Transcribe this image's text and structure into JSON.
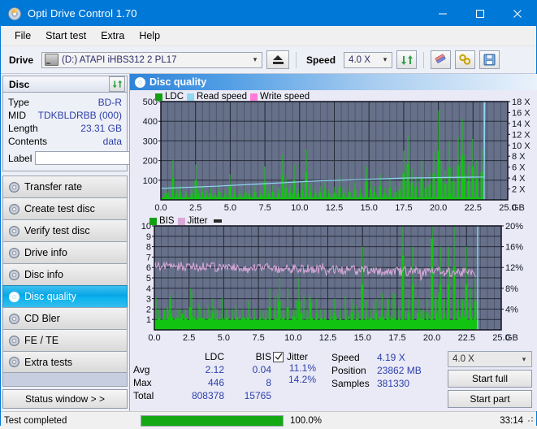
{
  "window": {
    "title": "Opti Drive Control 1.70",
    "icon": "disc-icon",
    "minimize": "minimize-icon",
    "maximize": "maximize-icon",
    "close": "close-icon"
  },
  "menu": {
    "items": [
      "File",
      "Start test",
      "Extra",
      "Help"
    ]
  },
  "toolbar": {
    "drive_label": "Drive",
    "drive_value": "(D:)   ATAPI iHBS312   2 PL17",
    "eject_title": "eject-button",
    "speed_label": "Speed",
    "speed_value": "4.0 X",
    "refresh_title": "refresh-button",
    "erase_title": "erase-button",
    "tools_title": "tools-button",
    "save_title": "save-button"
  },
  "disc_panel": {
    "title": "Disc",
    "refresh_title": "refresh-disc-button",
    "rows": [
      {
        "key": "Type",
        "value": "BD-R"
      },
      {
        "key": "MID",
        "value": "TDKBLDRBB (000)"
      },
      {
        "key": "Length",
        "value": "23.31 GB"
      },
      {
        "key": "Contents",
        "value": "data"
      }
    ],
    "label_key": "Label",
    "label_value": "",
    "label_placeholder": ""
  },
  "sidebar": {
    "items": [
      {
        "label": "Transfer rate",
        "active": false
      },
      {
        "label": "Create test disc",
        "active": false
      },
      {
        "label": "Verify test disc",
        "active": false
      },
      {
        "label": "Drive info",
        "active": false
      },
      {
        "label": "Disc info",
        "active": false
      },
      {
        "label": "Disc quality",
        "active": true
      },
      {
        "label": "CD Bler",
        "active": false
      },
      {
        "label": "FE / TE",
        "active": false
      },
      {
        "label": "Extra tests",
        "active": false
      }
    ],
    "status_window_button": "Status window > >"
  },
  "main": {
    "header_title": "Disc quality",
    "header_icon": "disc-quality-icon"
  },
  "stats": {
    "col_headers": [
      "",
      "LDC",
      "BIS"
    ],
    "rows": [
      {
        "label": "Avg",
        "ldc": "2.12",
        "bis": "0.04"
      },
      {
        "label": "Max",
        "ldc": "446",
        "bis": "8"
      },
      {
        "label": "Total",
        "ldc": "808378",
        "bis": "15765"
      }
    ],
    "jitter": {
      "checked": true,
      "label": "Jitter",
      "avg": "11.1%",
      "max": "14.2%"
    },
    "speed_label": "Speed",
    "speed_value": "4.19 X",
    "position_label": "Position",
    "position_value": "23862 MB",
    "samples_label": "Samples",
    "samples_value": "381330",
    "speed_select": "4.0 X",
    "start_full": "Start full",
    "start_part": "Start part"
  },
  "statusbar": {
    "message": "Test completed",
    "progress_percent": "100.0%",
    "progress_value": 100,
    "elapsed": "33:14"
  },
  "colors": {
    "accent": "#0078d7",
    "plot_bg": "#667089",
    "grid": "#3c4257",
    "ldc_green": "#12c412",
    "read_speed": "#8fd8f2",
    "write_speed": "#ff7ad9",
    "jitter_pink": "#d9a8d9",
    "value_blue": "#2b3fa8",
    "progress_green": "#15a815"
  },
  "chart_data": [
    {
      "type": "line",
      "title": "Disc quality - LDC / Read speed",
      "legend": [
        {
          "name": "LDC",
          "color": "#12c412"
        },
        {
          "name": "Read speed",
          "color": "#8fd8f2"
        },
        {
          "name": "Write speed",
          "color": "#ff7ad9"
        }
      ],
      "legend_position": "top-left",
      "xlabel": "GB",
      "x_ticks": [
        "0.0",
        "2.5",
        "5.0",
        "7.5",
        "10.0",
        "12.5",
        "15.0",
        "17.5",
        "20.0",
        "22.5",
        "25.0"
      ],
      "xlim": [
        0,
        25
      ],
      "ylabel_left": "LDC",
      "y_ticks_left": [
        "100",
        "200",
        "300",
        "400",
        "500"
      ],
      "ylim_left": [
        0,
        500
      ],
      "ylabel_right": "speed",
      "y_ticks_right": [
        "2 X",
        "4 X",
        "6 X",
        "8 X",
        "10 X",
        "12 X",
        "14 X",
        "16 X",
        "18 X"
      ],
      "ylim_right": [
        0,
        18
      ],
      "grid": true,
      "data_end_gb": 23.3,
      "series": [
        {
          "name": "LDC",
          "kind": "spikes",
          "baseline": 10,
          "peaks": [
            [
              0.35,
              60
            ],
            [
              0.55,
              40
            ],
            [
              0.9,
              205
            ],
            [
              1.1,
              55
            ],
            [
              1.4,
              70
            ],
            [
              1.8,
              45
            ],
            [
              2.2,
              60
            ],
            [
              2.5,
              180
            ],
            [
              2.7,
              50
            ],
            [
              3.0,
              70
            ],
            [
              3.3,
              45
            ],
            [
              3.6,
              60
            ],
            [
              3.9,
              42
            ],
            [
              4.2,
              75
            ],
            [
              4.6,
              50
            ],
            [
              5.0,
              130
            ],
            [
              5.3,
              60
            ],
            [
              5.7,
              45
            ],
            [
              6.1,
              65
            ],
            [
              6.4,
              50
            ],
            [
              6.8,
              70
            ],
            [
              7.2,
              48
            ],
            [
              7.5,
              170
            ],
            [
              7.8,
              55
            ],
            [
              8.1,
              75
            ],
            [
              8.5,
              60
            ],
            [
              8.8,
              230
            ],
            [
              9.0,
              110
            ],
            [
              9.3,
              70
            ],
            [
              9.6,
              180
            ],
            [
              9.9,
              60
            ],
            [
              10.2,
              90
            ],
            [
              10.5,
              255
            ],
            [
              10.8,
              80
            ],
            [
              11.1,
              60
            ],
            [
              11.5,
              70
            ],
            [
              11.8,
              90
            ],
            [
              12.1,
              55
            ],
            [
              12.5,
              65
            ],
            [
              12.9,
              120
            ],
            [
              13.2,
              60
            ],
            [
              13.6,
              75
            ],
            [
              14.0,
              90
            ],
            [
              14.4,
              60
            ],
            [
              14.8,
              170
            ],
            [
              15.1,
              95
            ],
            [
              15.4,
              70
            ],
            [
              15.8,
              130
            ],
            [
              16.1,
              65
            ],
            [
              16.5,
              110
            ],
            [
              16.9,
              70
            ],
            [
              17.2,
              90
            ],
            [
              17.5,
              250
            ],
            [
              17.8,
              330
            ],
            [
              18.1,
              160
            ],
            [
              18.4,
              120
            ],
            [
              18.8,
              200
            ],
            [
              19.1,
              110
            ],
            [
              19.4,
              140
            ],
            [
              19.7,
              245
            ],
            [
              20.0,
              455
            ],
            [
              20.2,
              200
            ],
            [
              20.5,
              150
            ],
            [
              20.8,
              300
            ],
            [
              21.1,
              170
            ],
            [
              21.4,
              320
            ],
            [
              21.7,
              410
            ],
            [
              21.9,
              230
            ],
            [
              22.2,
              180
            ],
            [
              22.5,
              310
            ],
            [
              22.8,
              200
            ],
            [
              23.1,
              260
            ]
          ]
        },
        {
          "name": "Read speed",
          "kind": "line",
          "points": [
            [
              0.0,
              2.1
            ],
            [
              1.0,
              2.2
            ],
            [
              2.5,
              2.35
            ],
            [
              4.0,
              2.5
            ],
            [
              5.5,
              2.7
            ],
            [
              7.0,
              2.9
            ],
            [
              8.5,
              3.1
            ],
            [
              10.0,
              3.3
            ],
            [
              11.5,
              3.5
            ],
            [
              13.0,
              3.6
            ],
            [
              14.5,
              3.75
            ],
            [
              16.0,
              3.85
            ],
            [
              17.5,
              4.0
            ],
            [
              19.0,
              4.05
            ],
            [
              20.5,
              4.1
            ],
            [
              22.0,
              4.15
            ],
            [
              23.3,
              4.2
            ],
            [
              23.35,
              18.0
            ]
          ]
        }
      ]
    },
    {
      "type": "line",
      "title": "Disc quality - BIS / Jitter",
      "legend": [
        {
          "name": "BIS",
          "color": "#12c412"
        },
        {
          "name": "Jitter",
          "color": "#d9a8d9"
        }
      ],
      "legend_position": "top-left",
      "xlabel": "GB",
      "x_ticks": [
        "0.0",
        "2.5",
        "5.0",
        "7.5",
        "10.0",
        "12.5",
        "15.0",
        "17.5",
        "20.0",
        "22.5",
        "25.0"
      ],
      "xlim": [
        0,
        25
      ],
      "ylabel_left": "BIS",
      "y_ticks_left": [
        "1",
        "2",
        "3",
        "4",
        "5",
        "6",
        "7",
        "8",
        "9",
        "10"
      ],
      "ylim_left": [
        0,
        10
      ],
      "ylabel_right": "Jitter",
      "y_ticks_right": [
        "4%",
        "8%",
        "12%",
        "16%",
        "20%"
      ],
      "ylim_right": [
        0,
        20
      ],
      "grid": true,
      "data_end_gb": 23.3,
      "series": [
        {
          "name": "BIS",
          "kind": "spikes",
          "baseline": 1,
          "peaks": [
            [
              0.3,
              2
            ],
            [
              0.7,
              2
            ],
            [
              1.0,
              2
            ],
            [
              1.2,
              3
            ],
            [
              1.5,
              2
            ],
            [
              1.7,
              2
            ],
            [
              1.9,
              2
            ],
            [
              2.2,
              2
            ],
            [
              2.6,
              4
            ],
            [
              2.9,
              2
            ],
            [
              3.2,
              2
            ],
            [
              3.6,
              2
            ],
            [
              4.0,
              2
            ],
            [
              4.2,
              3
            ],
            [
              4.5,
              2
            ],
            [
              4.9,
              2
            ],
            [
              5.2,
              2
            ],
            [
              5.6,
              2
            ],
            [
              6.0,
              2
            ],
            [
              6.4,
              2
            ],
            [
              6.8,
              2
            ],
            [
              7.2,
              2
            ],
            [
              7.6,
              2
            ],
            [
              8.0,
              2
            ],
            [
              8.3,
              4
            ],
            [
              8.7,
              2
            ],
            [
              9.0,
              5
            ],
            [
              9.3,
              2
            ],
            [
              9.6,
              4
            ],
            [
              10.0,
              2
            ],
            [
              10.4,
              5
            ],
            [
              10.6,
              3
            ],
            [
              11.0,
              2
            ],
            [
              11.3,
              2
            ],
            [
              11.7,
              3
            ],
            [
              12.0,
              2
            ],
            [
              12.3,
              2
            ],
            [
              12.7,
              2
            ],
            [
              13.0,
              3
            ],
            [
              13.4,
              2
            ],
            [
              13.8,
              2
            ],
            [
              14.2,
              3
            ],
            [
              14.6,
              2
            ],
            [
              15.0,
              8
            ],
            [
              15.3,
              2
            ],
            [
              15.6,
              2
            ],
            [
              16.0,
              3
            ],
            [
              16.4,
              2
            ],
            [
              16.8,
              3
            ],
            [
              17.2,
              2
            ],
            [
              17.6,
              2
            ],
            [
              17.9,
              13
            ],
            [
              18.3,
              3
            ],
            [
              18.6,
              8
            ],
            [
              19.0,
              3
            ],
            [
              19.4,
              2
            ],
            [
              19.7,
              3
            ],
            [
              20.0,
              16
            ],
            [
              20.3,
              3
            ],
            [
              20.6,
              8
            ],
            [
              20.9,
              3
            ],
            [
              21.2,
              8
            ],
            [
              21.6,
              11
            ],
            [
              21.9,
              3
            ],
            [
              22.2,
              3
            ],
            [
              22.5,
              8
            ],
            [
              22.8,
              4
            ],
            [
              23.1,
              5
            ]
          ]
        },
        {
          "name": "Jitter",
          "kind": "noisy-line",
          "mean_start": 12.3,
          "mean_end": 11.0,
          "noise": 0.9,
          "units": "%"
        }
      ]
    }
  ]
}
